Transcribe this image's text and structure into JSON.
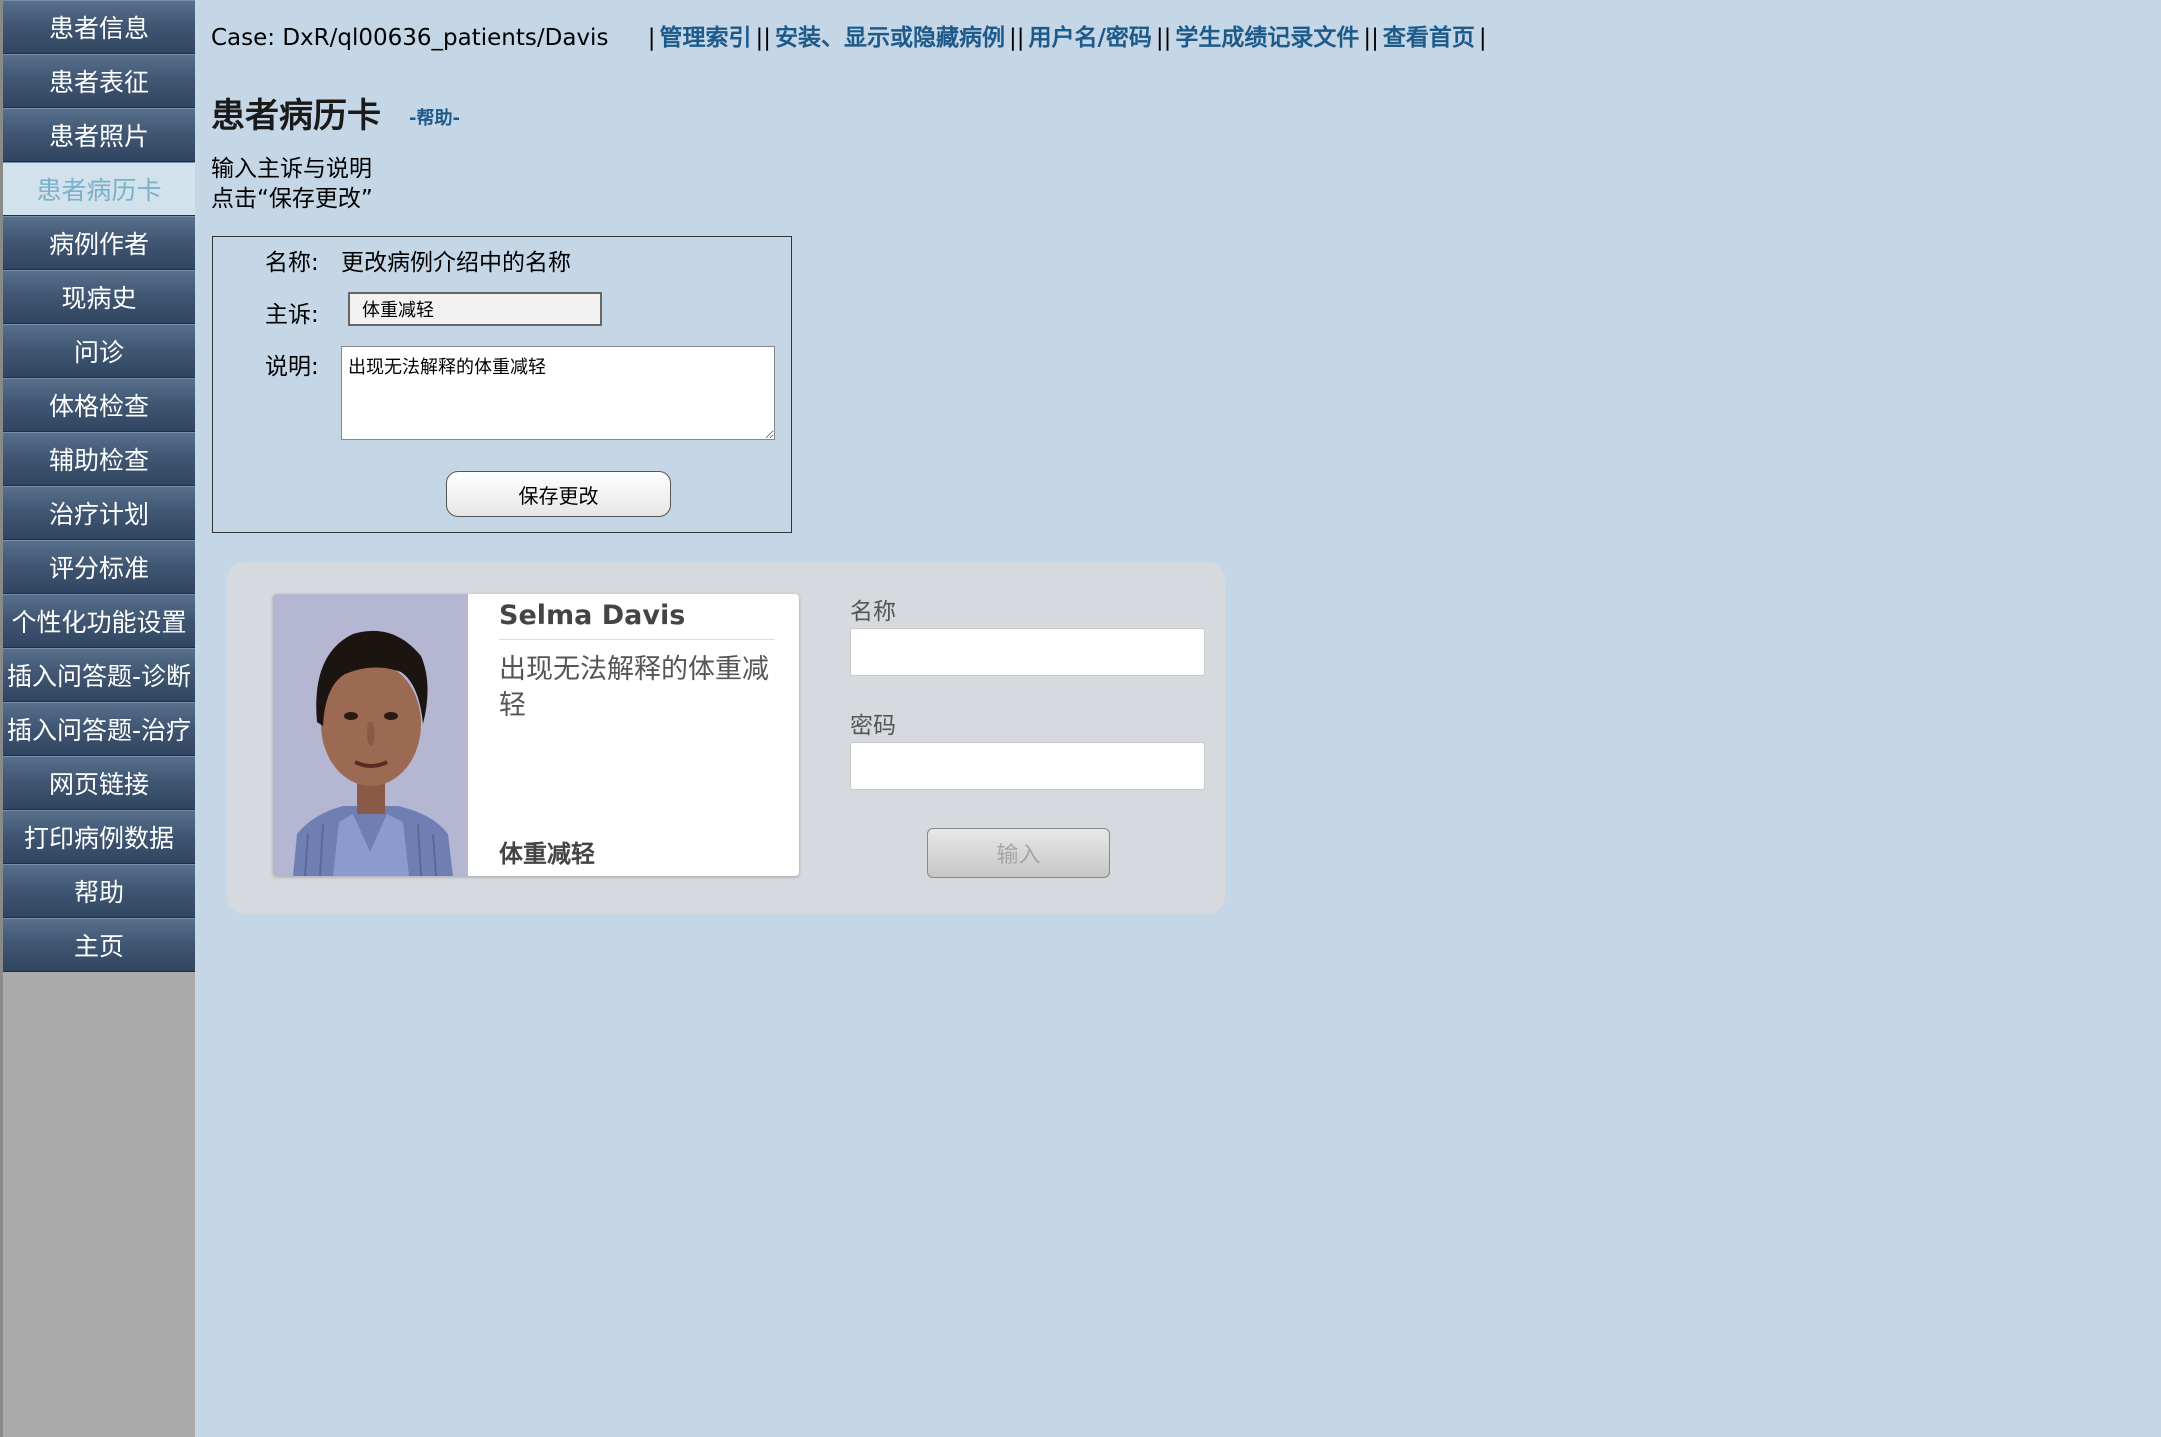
{
  "sidebar": {
    "items": [
      {
        "label": "患者信息"
      },
      {
        "label": "患者表征"
      },
      {
        "label": "患者照片"
      },
      {
        "label": "患者病历卡"
      },
      {
        "label": "病例作者"
      },
      {
        "label": "现病史"
      },
      {
        "label": "问诊"
      },
      {
        "label": "体格检查"
      },
      {
        "label": "辅助检查"
      },
      {
        "label": "治疗计划"
      },
      {
        "label": "评分标准"
      },
      {
        "label": "个性化功能设置"
      },
      {
        "label": "插入问答题-诊断"
      },
      {
        "label": "插入问答题-治疗"
      },
      {
        "label": "网页链接"
      },
      {
        "label": "打印病例数据"
      },
      {
        "label": "帮助"
      },
      {
        "label": "主页"
      }
    ],
    "active_index": 3
  },
  "topbar": {
    "case": "Case: DxR/ql00636_patients/Davis",
    "links": [
      "管理索引",
      "安装、显示或隐藏病例",
      "用户名/密码",
      "学生成绩记录文件",
      "查看首页"
    ]
  },
  "page": {
    "title": "患者病历卡",
    "help": "-帮助-",
    "instr_line1": "输入主诉与说明",
    "instr_line2": "点击“保存更改”"
  },
  "form": {
    "name_label": "名称:",
    "name_value": "更改病例介绍中的名称",
    "cc_label": "主诉:",
    "cc_value": "体重减轻",
    "desc_label": "说明:",
    "desc_value": "出现无法解释的体重减轻",
    "save_label": "保存更改"
  },
  "card": {
    "name": "Selma Davis",
    "desc": "出现无法解释的体重减轻",
    "cc": "体重减轻"
  },
  "login": {
    "name_label": "名称",
    "password_label": "密码",
    "button_label": "输入"
  }
}
